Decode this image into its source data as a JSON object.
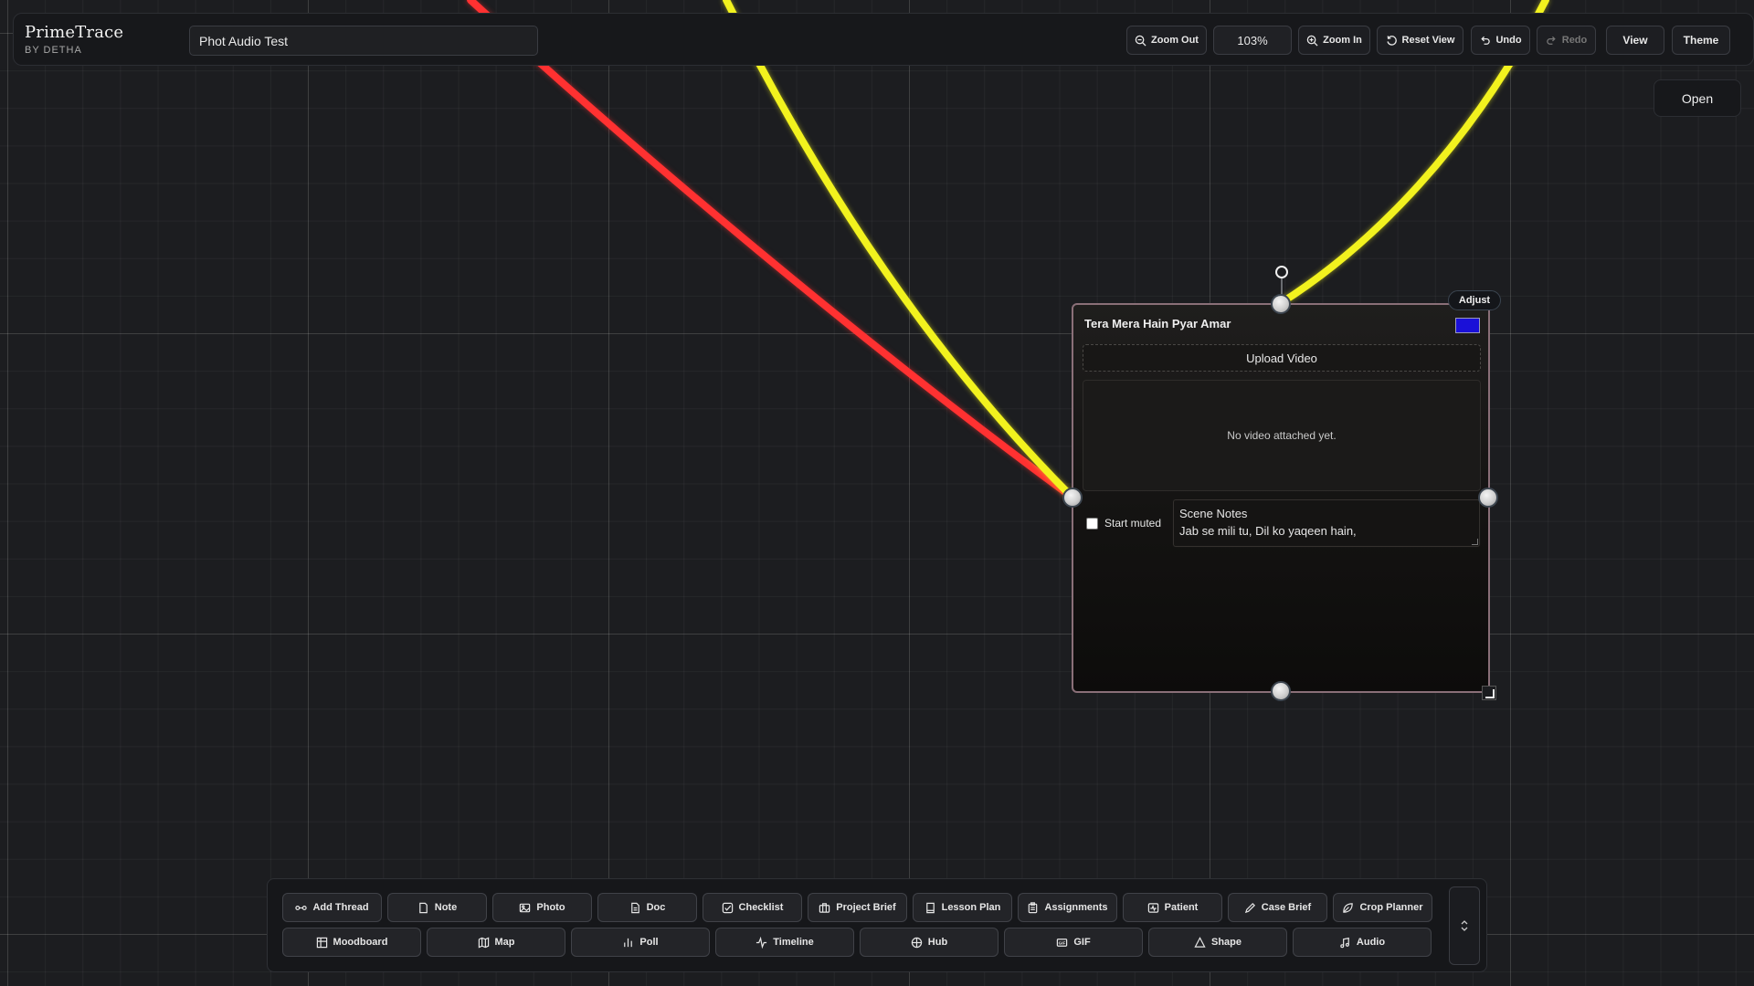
{
  "app": {
    "name": "PrimeTrace",
    "byline": "BY DETHA",
    "board_title": "Phot Audio Test"
  },
  "header": {
    "zoom_out": "Zoom Out",
    "zoom_level": "103%",
    "zoom_in": "Zoom In",
    "reset_view": "Reset View",
    "undo": "Undo",
    "redo": "Redo",
    "view": "View",
    "theme": "Theme"
  },
  "open_button": "Open",
  "node": {
    "title": "Tera Mera Hain Pyar Amar",
    "swatch_color": "#1a10d8",
    "adjust_label": "Adjust",
    "upload_label": "Upload Video",
    "empty_text": "No video attached yet.",
    "start_muted_label": "Start muted",
    "start_muted_checked": false,
    "notes_heading": "Scene Notes",
    "notes_text": "Jab se mili tu, Dil ko yaqeen hain,"
  },
  "wires": [
    {
      "color": "#ff3131",
      "name": "red-thread"
    },
    {
      "color": "#f2f21e",
      "name": "yellow-thread-left"
    },
    {
      "color": "#f2f21e",
      "name": "yellow-thread-top"
    }
  ],
  "toolbar": {
    "row1": [
      {
        "label": "Add Thread",
        "icon": "thread-icon"
      },
      {
        "label": "Note",
        "icon": "note-icon"
      },
      {
        "label": "Photo",
        "icon": "photo-icon"
      },
      {
        "label": "Doc",
        "icon": "doc-icon"
      },
      {
        "label": "Checklist",
        "icon": "checklist-icon"
      },
      {
        "label": "Project Brief",
        "icon": "briefcase-icon"
      },
      {
        "label": "Lesson Plan",
        "icon": "book-icon"
      },
      {
        "label": "Assignments",
        "icon": "clipboard-icon"
      },
      {
        "label": "Patient",
        "icon": "patient-icon"
      },
      {
        "label": "Case Brief",
        "icon": "pen-icon"
      },
      {
        "label": "Crop Planner",
        "icon": "leaf-icon"
      }
    ],
    "row2": [
      {
        "label": "Moodboard",
        "icon": "grid-icon"
      },
      {
        "label": "Map",
        "icon": "map-icon"
      },
      {
        "label": "Poll",
        "icon": "bar-chart-icon"
      },
      {
        "label": "Timeline",
        "icon": "pulse-icon"
      },
      {
        "label": "Hub",
        "icon": "hub-icon"
      },
      {
        "label": "GIF",
        "icon": "gif-icon"
      },
      {
        "label": "Shape",
        "icon": "triangle-icon"
      },
      {
        "label": "Audio",
        "icon": "music-icon"
      }
    ],
    "toggle_icon": "chevron-updown-icon"
  }
}
